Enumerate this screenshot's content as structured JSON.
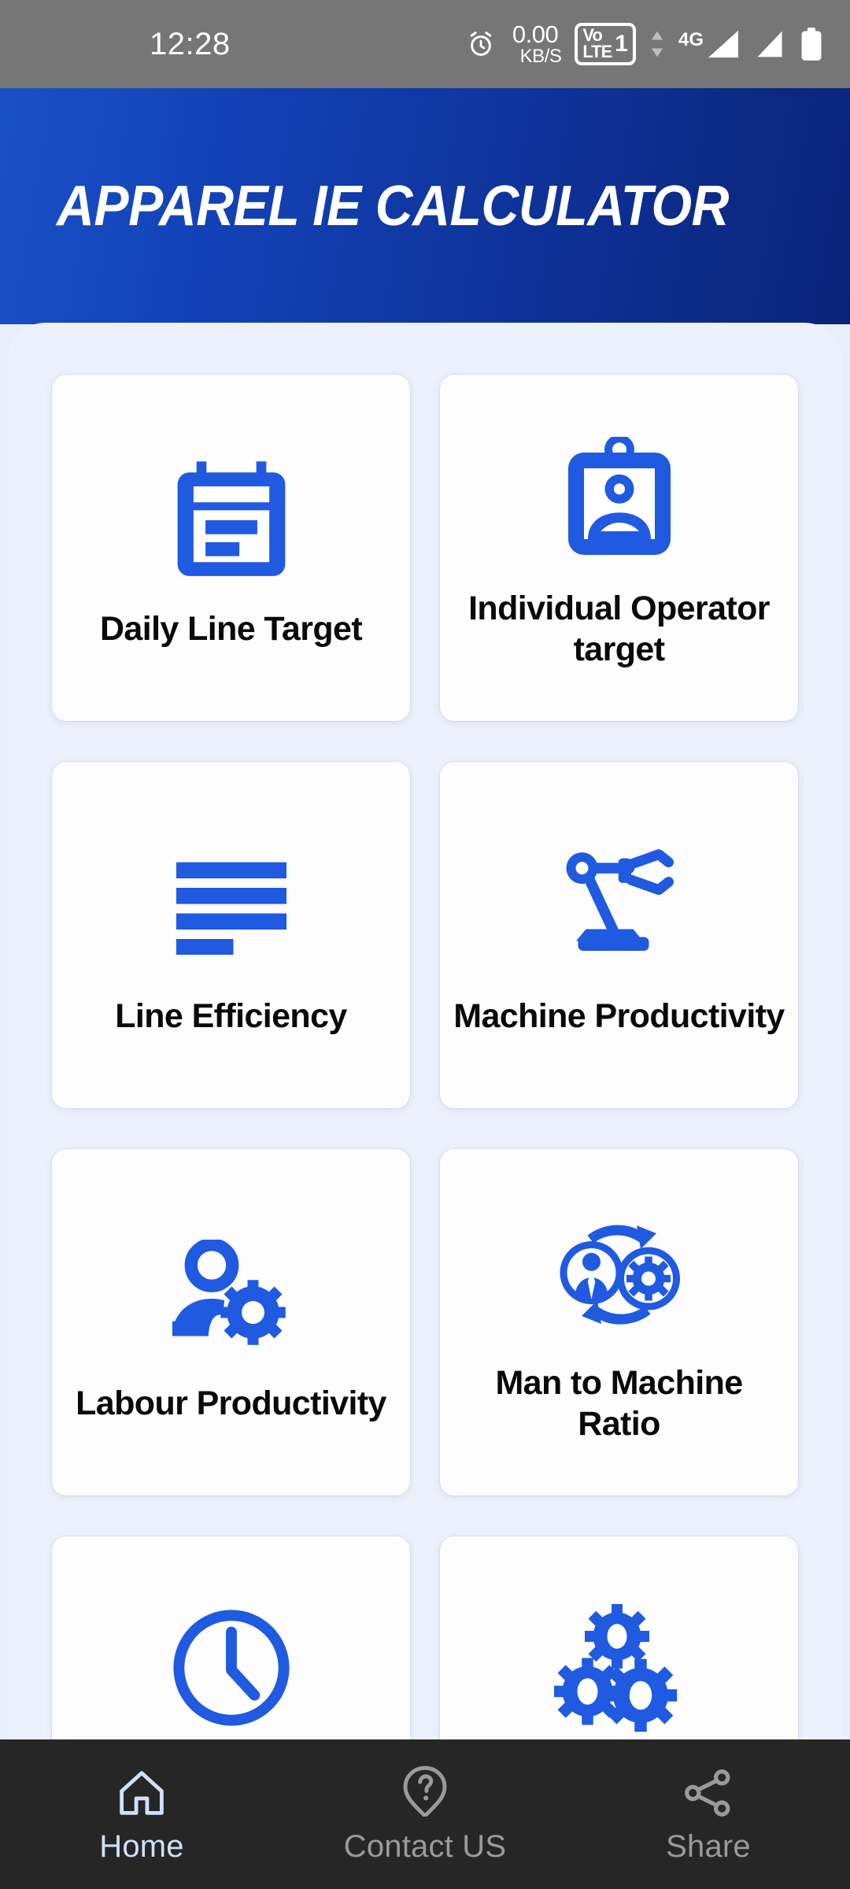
{
  "statusbar": {
    "time": "12:28",
    "network_speed_value": "0.00",
    "network_speed_unit": "KB/S",
    "volte_top": "Vo",
    "volte_bottom": "LTE",
    "sim_number": "1",
    "network_type": "4G",
    "icons": {
      "alarm": "alarm-clock-icon",
      "volte": "volte-badge-icon",
      "data_arrows": "data-transfer-arrows-icon",
      "signal_1": "signal-bars-icon",
      "signal_2": "signal-bars-icon",
      "battery": "battery-icon"
    }
  },
  "header": {
    "title": "APPAREL IE CALCULATOR",
    "gradient_from": "#1a50c6",
    "gradient_to": "#0a2378"
  },
  "theme": {
    "accent_blue": "#1f5ae0",
    "panel_bg": "#edf1fc",
    "card_bg": "#fdfdfe",
    "label_color": "#0a0a0a",
    "nav_bg": "#262626",
    "nav_active_color": "#cfe1f7",
    "nav_inactive_color": "#9a9a9a"
  },
  "main": {
    "cards": [
      {
        "label": "Daily Line Target",
        "icon": "calendar-schedule-icon"
      },
      {
        "label": "Individual Operator target",
        "icon": "id-badge-person-icon"
      },
      {
        "label": "Line Efficiency",
        "icon": "horizontal-bars-icon"
      },
      {
        "label": "Machine Productivity",
        "icon": "robot-arm-icon"
      },
      {
        "label": "Labour Productivity",
        "icon": "person-gear-icon"
      },
      {
        "label": "Man to Machine Ratio",
        "icon": "person-gear-cycle-icon"
      },
      {
        "label": "",
        "icon": "clock-icon"
      },
      {
        "label": "",
        "icon": "three-gears-icon"
      }
    ]
  },
  "bottomnav": {
    "items": [
      {
        "label": "Home",
        "icon": "home-icon",
        "active": true
      },
      {
        "label": "Contact US",
        "icon": "question-help-icon",
        "active": false
      },
      {
        "label": "Share",
        "icon": "share-nodes-icon",
        "active": false
      }
    ]
  }
}
